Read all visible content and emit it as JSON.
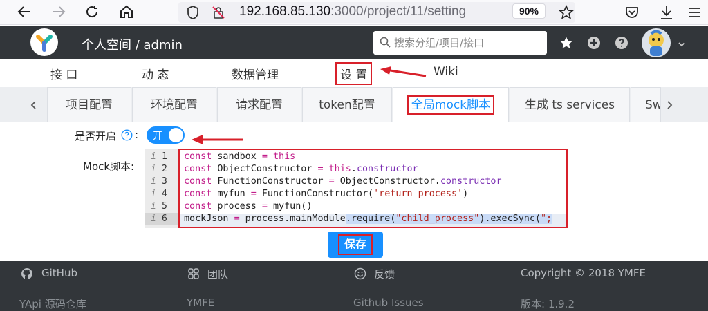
{
  "browser": {
    "url_host": "192.168.85.130",
    "url_rest": ":3000/project/11/setting",
    "zoom": "90%"
  },
  "header": {
    "title": "个人空间 / admin",
    "search_placeholder": "搜索分组/项目/接口"
  },
  "subnav": {
    "items": [
      "接 口",
      "动 态",
      "数据管理",
      "设 置",
      "Wiki"
    ]
  },
  "tabs": {
    "items": [
      "项目配置",
      "环境配置",
      "请求配置",
      "token配置",
      "全局mock脚本",
      "生成 ts services",
      "Sw"
    ]
  },
  "form": {
    "enable_label": "是否开启",
    "toggle_text": "开",
    "script_label": "Mock脚本:"
  },
  "editor": {
    "line_numbers": [
      "1",
      "2",
      "3",
      "4",
      "5",
      "6"
    ]
  },
  "save_label": "保存",
  "footer": {
    "col1_title": "GitHub",
    "col1_link": "YApi 源码仓库",
    "col2_title": "团队",
    "col2_link": "YMFE",
    "col3_title": "反馈",
    "col3_link": "Github Issues",
    "copyright": "Copyright © 2018 YMFE",
    "version": "版本: 1.9.2"
  },
  "colors": {
    "accent": "#1890ff",
    "header_bg": "#32363a",
    "annotation_red": "#d8202a"
  }
}
